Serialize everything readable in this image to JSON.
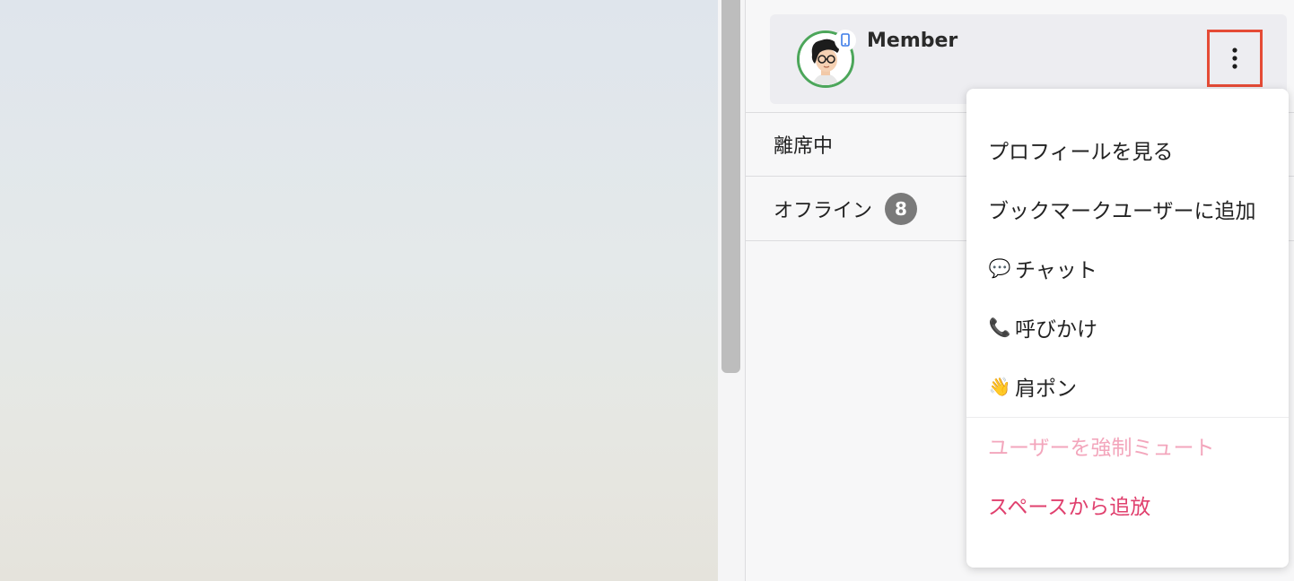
{
  "member_card": {
    "name": "Member",
    "avatar_ring_color": "#4ca65a",
    "device_icon": "mobile-device-icon"
  },
  "sections": [
    {
      "label": "離席中"
    },
    {
      "label": "オフライン",
      "count": "8"
    }
  ],
  "context_menu": {
    "items": [
      {
        "label": "プロフィールを見る"
      },
      {
        "label": "ブックマークユーザーに追加"
      },
      {
        "emoji": "💬",
        "label": "チャット"
      },
      {
        "emoji": "📞",
        "label": "呼びかけ"
      },
      {
        "emoji": "👋",
        "label": "肩ポン"
      }
    ],
    "danger_items": [
      {
        "label": "ユーザーを強制ミュート",
        "color": "#f3a6bc"
      },
      {
        "label": "スペースから追放",
        "color": "#e0406e"
      }
    ]
  },
  "colors": {
    "highlight_border": "#e54b36",
    "count_badge": "#7a7a7a"
  }
}
